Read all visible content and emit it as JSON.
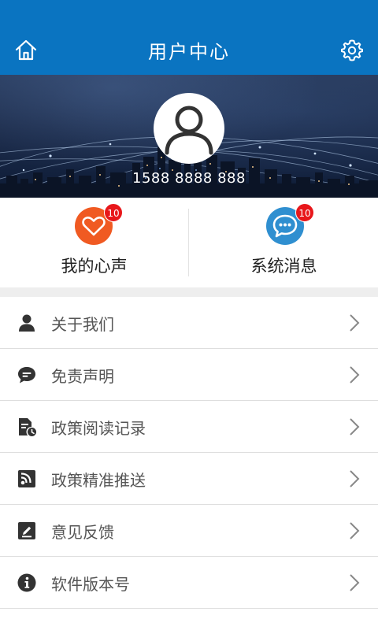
{
  "header": {
    "title": "用户中心",
    "home_icon": "home-icon",
    "settings_icon": "gear-icon",
    "background_color": "#0a74c1"
  },
  "profile": {
    "avatar_icon": "user-avatar-icon",
    "phone": "1588 8888 888"
  },
  "quick_actions": [
    {
      "label": "我的心声",
      "icon": "heart-icon",
      "badge": "10",
      "color": "#f05a22"
    },
    {
      "label": "系统消息",
      "icon": "chat-bubble-icon",
      "badge": "10",
      "color": "#2f8fd0"
    }
  ],
  "menu": {
    "items": [
      {
        "label": "关于我们",
        "icon": "person-icon"
      },
      {
        "label": "免责声明",
        "icon": "speech-bubble-icon"
      },
      {
        "label": "政策阅读记录",
        "icon": "document-clock-icon"
      },
      {
        "label": "政策精准推送",
        "icon": "rss-icon"
      },
      {
        "label": "意见反馈",
        "icon": "edit-icon"
      },
      {
        "label": "软件版本号",
        "icon": "info-icon"
      }
    ],
    "chevron_icon": "chevron-right-icon"
  }
}
